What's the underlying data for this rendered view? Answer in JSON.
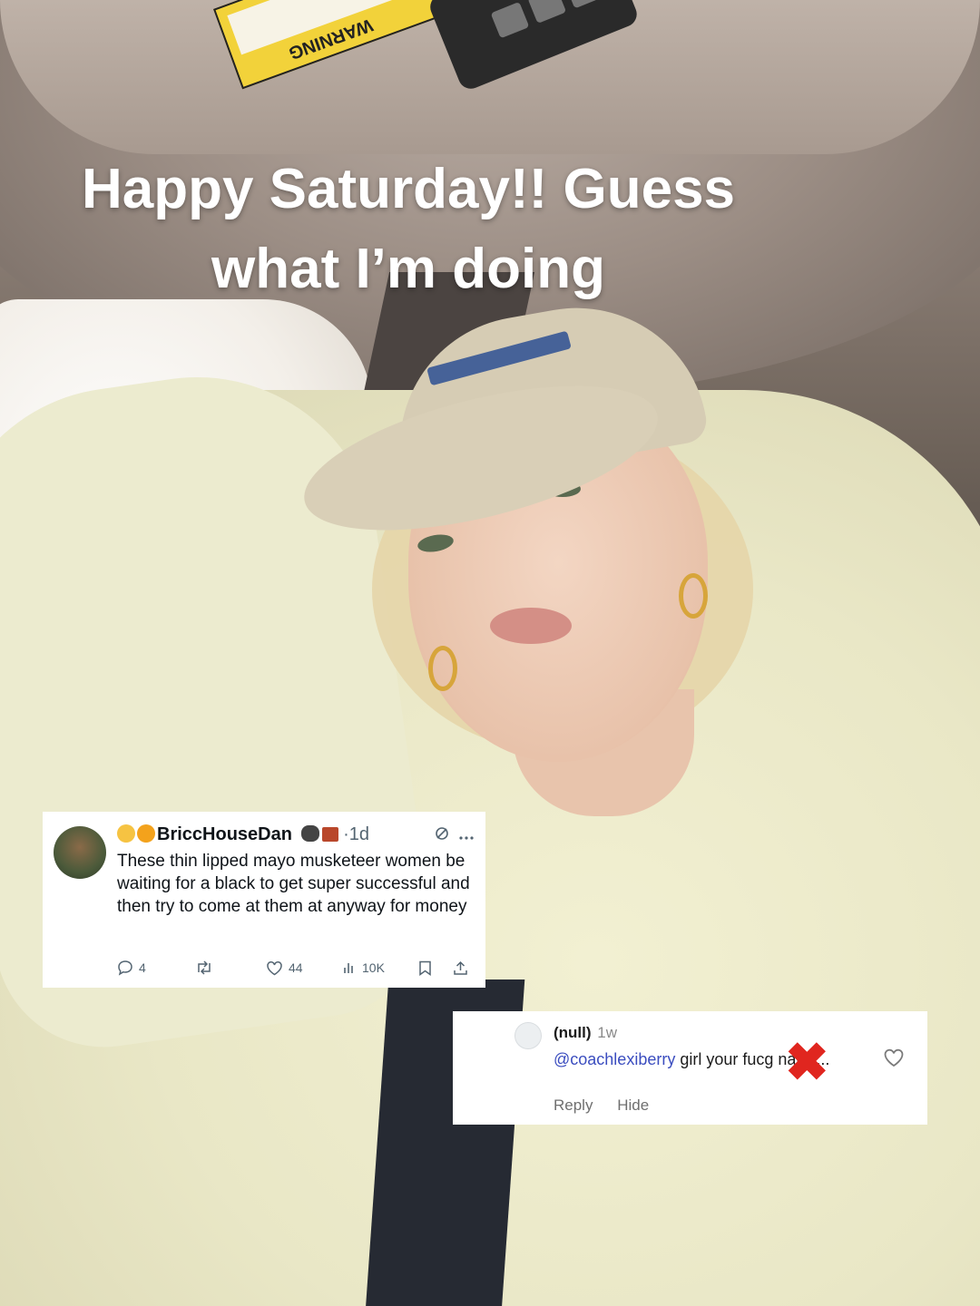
{
  "caption": {
    "line1": "Happy Saturday!! Guess",
    "line2": "what I’m doing"
  },
  "visor_label": "WARNING",
  "tweet": {
    "username": "BriccHouseDan",
    "time_separator": "·",
    "time": "1d",
    "body": "These thin lipped mayo musketeer women be waiting for a black to get super successful and then try to come at them at anyway for money",
    "replies": "4",
    "likes": "44",
    "views": "10K",
    "icons": [
      "reply-icon",
      "retweet-icon",
      "like-icon",
      "views-icon",
      "bookmark-icon",
      "share-icon",
      "grok-icon",
      "more-icon"
    ]
  },
  "comment": {
    "username": "(null)",
    "age": "1w",
    "mention": "@coachlexiberry",
    "text_before_censor": " girl your fuc",
    "text_after_censor": "g nails....",
    "reply_label": "Reply",
    "hide_label": "Hide",
    "censor_mark": "✖",
    "censor_color": "#e0261f"
  }
}
